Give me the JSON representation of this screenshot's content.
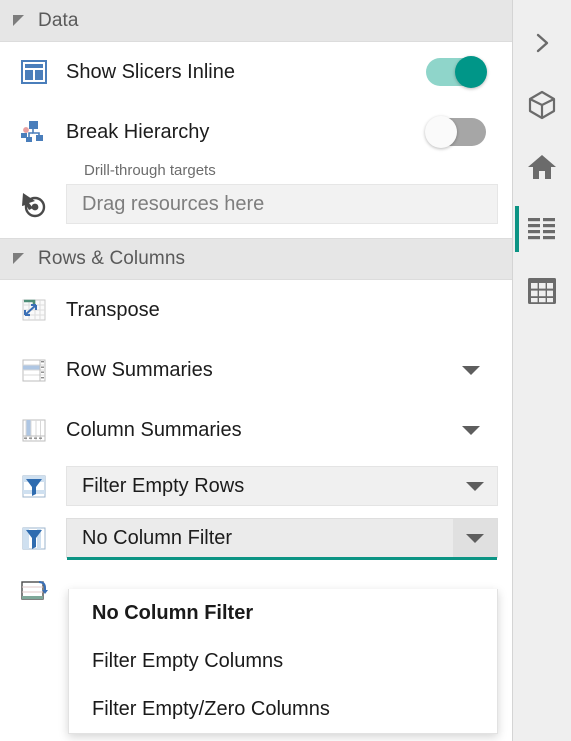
{
  "theme": {
    "accent_teal": "#0c9484",
    "toggle_on": "#009688",
    "toggle_on_track": "#8fd5ca",
    "toggle_off_track": "#a6a6a6",
    "section_header_bg": "#e6e6e6",
    "panel_bg": "#ffffff",
    "rail_bg": "#efefef",
    "icon_blue": "#4a7ebb",
    "text_primary": "#1c1c1c",
    "text_muted": "#6c6c6c"
  },
  "sections": [
    {
      "id": "data",
      "title": "Data",
      "expanded": true,
      "collapse_icon": "triangle-expanded-icon"
    },
    {
      "id": "rows-columns",
      "title": "Rows & Columns",
      "expanded": true,
      "collapse_icon": "triangle-expanded-icon"
    }
  ],
  "data_section": {
    "show_slicers": {
      "label": "Show Slicers Inline",
      "icon": "slicers-inline-icon",
      "toggle_state": "on"
    },
    "break_hierarchy": {
      "label": "Break Hierarchy",
      "icon": "hierarchy-icon",
      "toggle_state": "off"
    },
    "drill_through": {
      "caption": "Drill-through targets",
      "icon": "drill-through-icon",
      "placeholder": "Drag resources here",
      "value": ""
    }
  },
  "rows_columns_section": {
    "transpose": {
      "label": "Transpose",
      "icon": "transpose-icon"
    },
    "row_summaries": {
      "label": "Row Summaries",
      "icon": "row-summaries-icon",
      "caret": "chevron-down-icon"
    },
    "column_summaries": {
      "label": "Column Summaries",
      "icon": "column-summaries-icon",
      "caret": "chevron-down-icon"
    },
    "row_filter": {
      "icon": "filter-rows-icon",
      "selected": "Filter Empty Rows",
      "caret": "chevron-down-icon",
      "open": false
    },
    "column_filter": {
      "icon": "filter-columns-icon",
      "selected": "No Column Filter",
      "caret": "chevron-down-icon",
      "open": true,
      "options": [
        {
          "label": "No Column Filter",
          "selected": true
        },
        {
          "label": "Filter Empty Columns",
          "selected": false
        },
        {
          "label": "Filter Empty/Zero Columns",
          "selected": false
        }
      ]
    },
    "next_row_partial": {
      "icon": "sheet-swap-icon"
    }
  },
  "right_rail": {
    "items": [
      {
        "id": "expand",
        "icon": "chevron-right-icon",
        "active": false
      },
      {
        "id": "model",
        "icon": "cube-icon",
        "active": false
      },
      {
        "id": "home",
        "icon": "home-icon",
        "active": false
      },
      {
        "id": "layout",
        "icon": "list-align-icon",
        "active": true
      },
      {
        "id": "table",
        "icon": "grid-table-icon",
        "active": false
      }
    ]
  }
}
